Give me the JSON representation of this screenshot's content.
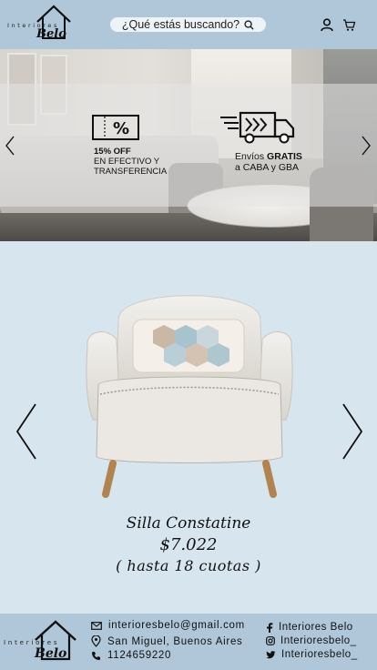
{
  "header": {
    "logo": {
      "wordmark": "Interiores",
      "script": "Belo"
    },
    "search": {
      "placeholder": "¿Qué estás buscando?",
      "icon": "search-icon"
    },
    "icons": [
      "user-icon",
      "cart-icon"
    ]
  },
  "banner": {
    "promo_discount": {
      "line1": "15% OFF",
      "line2": "EN EFECTIVO Y",
      "line3": "TRANSFERENCIA",
      "icon": "ticket-percent-icon"
    },
    "promo_shipping": {
      "line1_prefix": "Envíos ",
      "line1_bold": "GRATIS",
      "line2": "a CABA y GBA",
      "icon": "delivery-truck-icon"
    },
    "nav": [
      "chevron-left-icon",
      "chevron-right-icon"
    ]
  },
  "product": {
    "name": "Silla Constatine",
    "price": "$7.022",
    "installments": "( hasta 18 cuotas )",
    "nav": [
      "chevron-left-icon",
      "chevron-right-icon"
    ]
  },
  "footer": {
    "logo": {
      "wordmark": "Interiores",
      "script": "Belo"
    },
    "email": "interioresbelo@gmail.com",
    "location": "San Miguel, Buenos Aires",
    "phone": "1124659220",
    "facebook": "Interiores Belo",
    "instagram": "Interioresbelo_",
    "twitter": "Interioresbelo_",
    "icons": [
      "mail-icon",
      "location-pin-icon",
      "phone-icon",
      "facebook-icon",
      "instagram-icon",
      "twitter-icon"
    ]
  },
  "colors": {
    "header_bg": "#afc7d9",
    "page_bg": "#d7e5ef",
    "search_bg": "#eef3f7"
  }
}
